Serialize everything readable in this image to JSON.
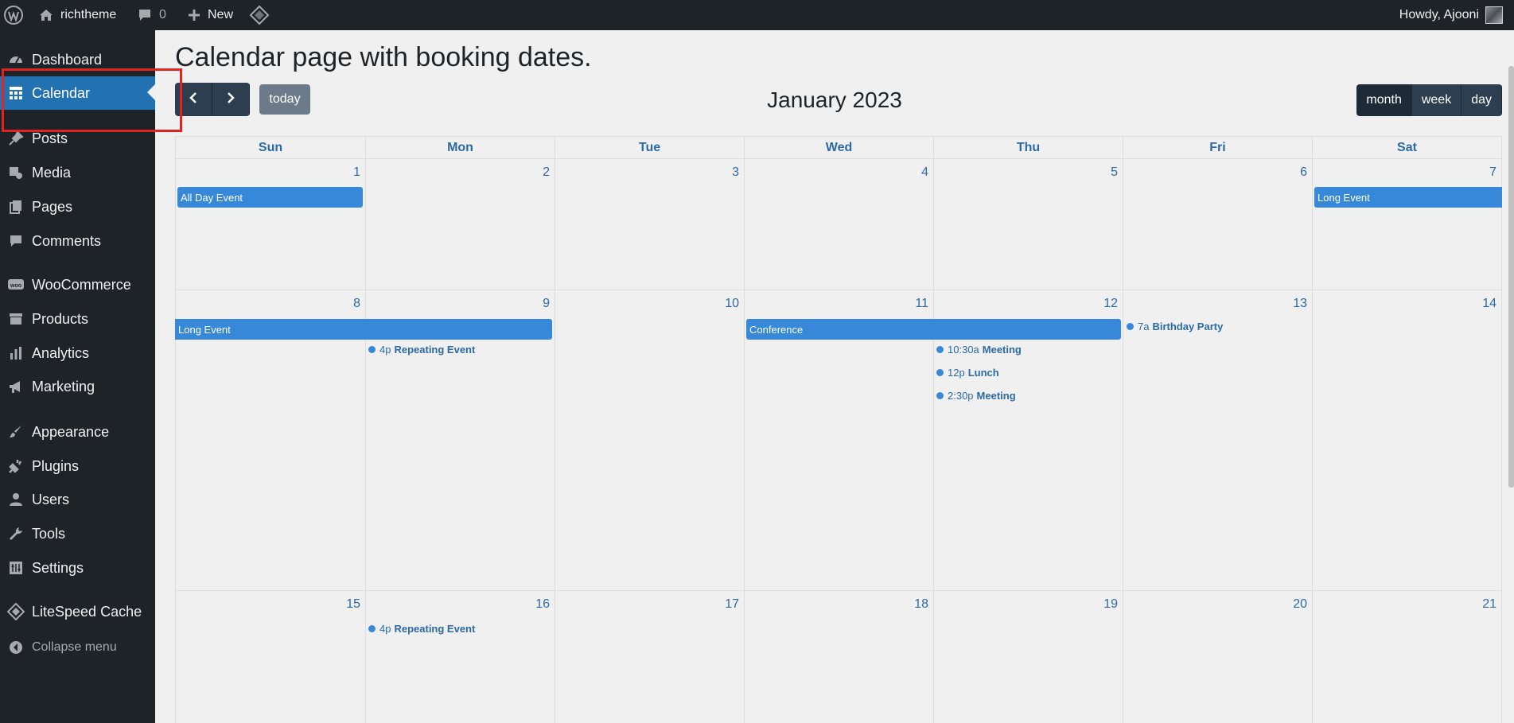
{
  "adminbar": {
    "site_name": "richtheme",
    "comments_count": "0",
    "new_label": "New",
    "howdy": "Howdy, Ajooni"
  },
  "sidebar": {
    "items": [
      {
        "label": "Dashboard",
        "icon": "dashboard-icon"
      },
      {
        "label": "Calendar",
        "icon": "calendar-grid-icon",
        "active": true
      },
      {
        "label": "Posts",
        "icon": "pin-icon"
      },
      {
        "label": "Media",
        "icon": "media-icon"
      },
      {
        "label": "Pages",
        "icon": "pages-icon"
      },
      {
        "label": "Comments",
        "icon": "comment-icon"
      },
      {
        "label": "WooCommerce",
        "icon": "woocommerce-icon"
      },
      {
        "label": "Products",
        "icon": "archive-box-icon"
      },
      {
        "label": "Analytics",
        "icon": "bar-chart-icon"
      },
      {
        "label": "Marketing",
        "icon": "megaphone-icon"
      },
      {
        "label": "Appearance",
        "icon": "paintbrush-icon"
      },
      {
        "label": "Plugins",
        "icon": "plug-icon"
      },
      {
        "label": "Users",
        "icon": "user-icon"
      },
      {
        "label": "Tools",
        "icon": "wrench-icon"
      },
      {
        "label": "Settings",
        "icon": "settings-sliders-icon"
      },
      {
        "label": "LiteSpeed Cache",
        "icon": "litespeed-icon"
      }
    ],
    "collapse_label": "Collapse menu"
  },
  "page": {
    "title": "Calendar page with booking dates."
  },
  "calendar": {
    "today_label": "today",
    "title": "January 2023",
    "views": [
      "month",
      "week",
      "day"
    ],
    "active_view": "month",
    "days_of_week": [
      "Sun",
      "Mon",
      "Tue",
      "Wed",
      "Thu",
      "Fri",
      "Sat"
    ],
    "weeks": [
      [
        "1",
        "2",
        "3",
        "4",
        "5",
        "6",
        "7"
      ],
      [
        "8",
        "9",
        "10",
        "11",
        "12",
        "13",
        "14"
      ],
      [
        "15",
        "16",
        "17",
        "18",
        "19",
        "20",
        "21"
      ]
    ],
    "events": {
      "all_day_event": "All Day Event",
      "long_event_1": "Long Event",
      "long_event_2": "Long Event",
      "conference": "Conference",
      "repeating_1": {
        "time": "4p",
        "title": "Repeating Event"
      },
      "birthday": {
        "time": "7a",
        "title": "Birthday Party"
      },
      "meeting_1": {
        "time": "10:30a",
        "title": "Meeting"
      },
      "lunch": {
        "time": "12p",
        "title": "Lunch"
      },
      "meeting_2": {
        "time": "2:30p",
        "title": "Meeting"
      },
      "repeating_2": {
        "time": "4p",
        "title": "Repeating Event"
      }
    }
  },
  "colors": {
    "accent": "#2271b1",
    "event": "#3788d8",
    "adminbar": "#1d2327",
    "highlight": "#e02424"
  }
}
